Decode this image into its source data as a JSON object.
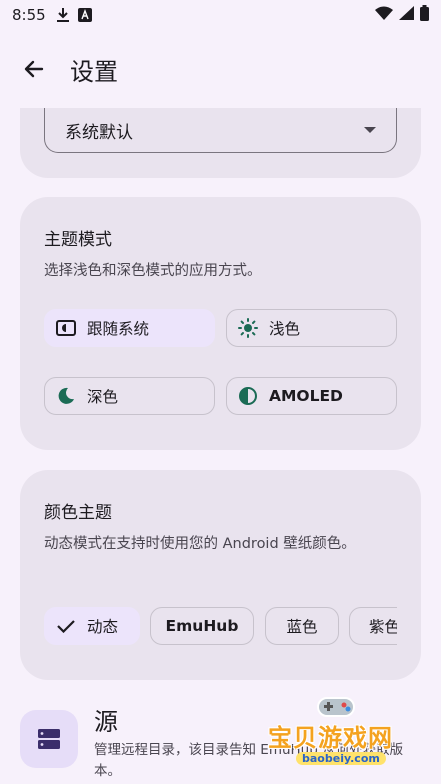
{
  "status": {
    "time": "8:55"
  },
  "header": {
    "title": "设置"
  },
  "language_card": {
    "selected_value": "系统默认"
  },
  "theme_card": {
    "title": "主题模式",
    "description": "选择浅色和深色模式的应用方式。",
    "options": [
      {
        "label": "跟随系统",
        "selected": true
      },
      {
        "label": "浅色",
        "selected": false
      },
      {
        "label": "深色",
        "selected": false
      },
      {
        "label": "AMOLED",
        "selected": false
      }
    ]
  },
  "color_card": {
    "title": "颜色主题",
    "description": "动态模式在支持时使用您的 Android 壁纸颜色。",
    "options": [
      {
        "label": "动态",
        "selected": true
      },
      {
        "label": "EmuHub",
        "selected": false
      },
      {
        "label": "蓝色",
        "selected": false
      },
      {
        "label": "紫色",
        "selected": false
      }
    ]
  },
  "source": {
    "title": "源",
    "description": "管理远程目录，该目录告知 EmuHub 从何处获取版本。"
  },
  "watermark": {
    "text": "宝贝游戏网",
    "url": "baobeiy.com"
  },
  "colors": {
    "accent": "#1b6b55",
    "card": "#e9e3ee",
    "selected_chip": "#ece4fb",
    "background": "#f7f1fb"
  }
}
